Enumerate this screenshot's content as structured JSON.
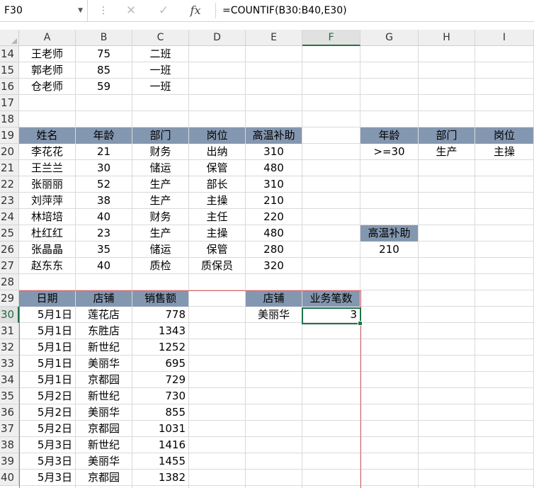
{
  "formula_bar": {
    "name_box": "F30",
    "formula": "=COUNTIF(B30:B40,E30)"
  },
  "columns": [
    "A",
    "B",
    "C",
    "D",
    "E",
    "F",
    "G",
    "H",
    "I"
  ],
  "rows": [
    "14",
    "15",
    "16",
    "17",
    "18",
    "19",
    "20",
    "21",
    "22",
    "23",
    "24",
    "25",
    "26",
    "27",
    "28",
    "29",
    "30",
    "31",
    "32",
    "33",
    "34",
    "35",
    "36",
    "37",
    "38",
    "39",
    "40"
  ],
  "selected_column": "F",
  "selected_row": "30",
  "teachers": [
    {
      "name": "王老师",
      "score": "75",
      "class": "二班"
    },
    {
      "name": "郭老师",
      "score": "85",
      "class": "一班"
    },
    {
      "name": "仓老师",
      "score": "59",
      "class": "一班"
    }
  ],
  "staff_table": {
    "headers": [
      "姓名",
      "年龄",
      "部门",
      "岗位",
      "高温补助"
    ],
    "rows": [
      [
        "李花花",
        "21",
        "财务",
        "出纳",
        "310"
      ],
      [
        "王兰兰",
        "30",
        "储运",
        "保管",
        "480"
      ],
      [
        "张丽丽",
        "52",
        "生产",
        "部长",
        "310"
      ],
      [
        "刘萍萍",
        "38",
        "生产",
        "主操",
        "210"
      ],
      [
        "林培培",
        "40",
        "财务",
        "主任",
        "220"
      ],
      [
        "杜红红",
        "23",
        "生产",
        "主操",
        "480"
      ],
      [
        "张晶晶",
        "35",
        "储运",
        "保管",
        "280"
      ],
      [
        "赵东东",
        "40",
        "质检",
        "质保员",
        "320"
      ]
    ]
  },
  "criteria": {
    "headers": [
      "年龄",
      "部门",
      "岗位"
    ],
    "values": [
      ">=30",
      "生产",
      "主操"
    ]
  },
  "result": {
    "header": "高温补助",
    "value": "210"
  },
  "sales_table": {
    "headers": [
      "日期",
      "店铺",
      "销售额"
    ],
    "rows": [
      [
        "5月1日",
        "莲花店",
        "778"
      ],
      [
        "5月1日",
        "东胜店",
        "1343"
      ],
      [
        "5月1日",
        "新世纪",
        "1252"
      ],
      [
        "5月1日",
        "美丽华",
        "695"
      ],
      [
        "5月1日",
        "京都园",
        "729"
      ],
      [
        "5月2日",
        "新世纪",
        "730"
      ],
      [
        "5月2日",
        "美丽华",
        "855"
      ],
      [
        "5月2日",
        "京都园",
        "1031"
      ],
      [
        "5月3日",
        "新世纪",
        "1416"
      ],
      [
        "5月3日",
        "美丽华",
        "1455"
      ],
      [
        "5月3日",
        "京都园",
        "1382"
      ]
    ]
  },
  "count_table": {
    "headers": [
      "店铺",
      "业务笔数"
    ],
    "store": "美丽华",
    "count": "3"
  },
  "colors": {
    "header_fill": "#8497b0",
    "selection": "#217346",
    "reference_border": "#e0636b"
  }
}
